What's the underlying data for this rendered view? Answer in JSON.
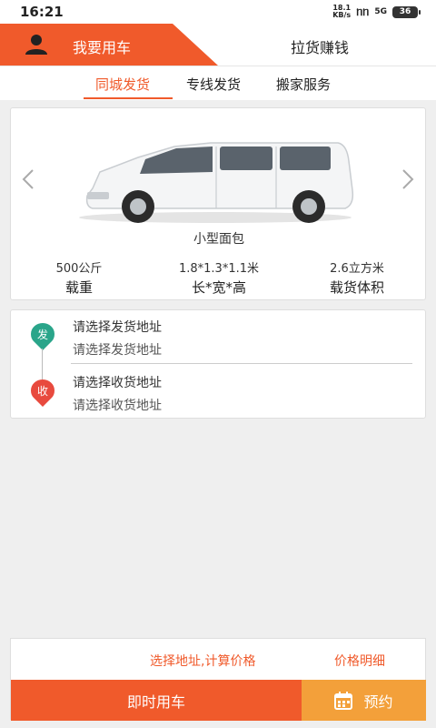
{
  "status_bar": {
    "time": "16:21",
    "net_speed_value": "18.1",
    "net_speed_unit": "KB/s",
    "signal_text": "ᥒᥒ",
    "network_type": "5G",
    "battery_level": "36"
  },
  "top_nav": {
    "tabs": [
      {
        "label": "我要用车"
      },
      {
        "label": "拉货赚钱"
      }
    ]
  },
  "sub_tabs": [
    {
      "label": "同城发货"
    },
    {
      "label": "专线发货"
    },
    {
      "label": "搬家服务"
    }
  ],
  "vehicle": {
    "name": "小型面包",
    "specs": [
      {
        "value": "500公斤",
        "label": "载重"
      },
      {
        "value": "1.8*1.3*1.1米",
        "label": "长*宽*高"
      },
      {
        "value": "2.6立方米",
        "label": "载货体积"
      }
    ]
  },
  "address": {
    "send_badge": "发",
    "receive_badge": "收",
    "send_title": "请选择发货地址",
    "send_subtitle": "请选择发货地址",
    "receive_title": "请选择收货地址",
    "receive_subtitle": "请选择收货地址"
  },
  "bottom": {
    "price_hint": "选择地址,计算价格",
    "price_detail": "价格明细",
    "now_button": "即时用车",
    "book_button": "预约"
  },
  "colors": {
    "accent": "#f05a2b",
    "book_button": "#f3a03a",
    "send_pin": "#2aa58a",
    "receive_pin": "#e84a3e"
  }
}
